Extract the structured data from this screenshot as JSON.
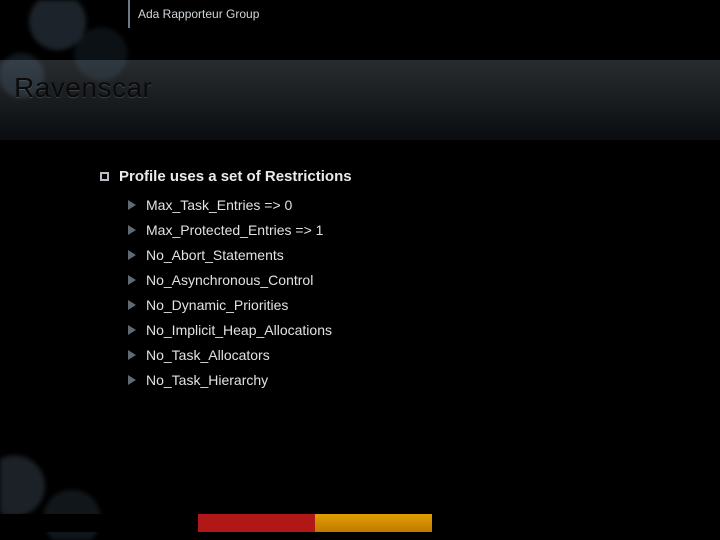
{
  "header": {
    "group_name": "Ada Rapporteur Group"
  },
  "title": "Ravenscar",
  "content": {
    "heading": "Profile uses a set of Restrictions",
    "items": [
      "Max_Task_Entries => 0",
      "Max_Protected_Entries => 1",
      "No_Abort_Statements",
      "No_Asynchronous_Control",
      "No_Dynamic_Priorities",
      "No_Implicit_Heap_Allocations",
      "No_Task_Allocators",
      "No_Task_Hierarchy"
    ]
  },
  "colors": {
    "stripe_black": "#000000",
    "stripe_red": "#b01818",
    "stripe_gold": "#d08c00"
  }
}
